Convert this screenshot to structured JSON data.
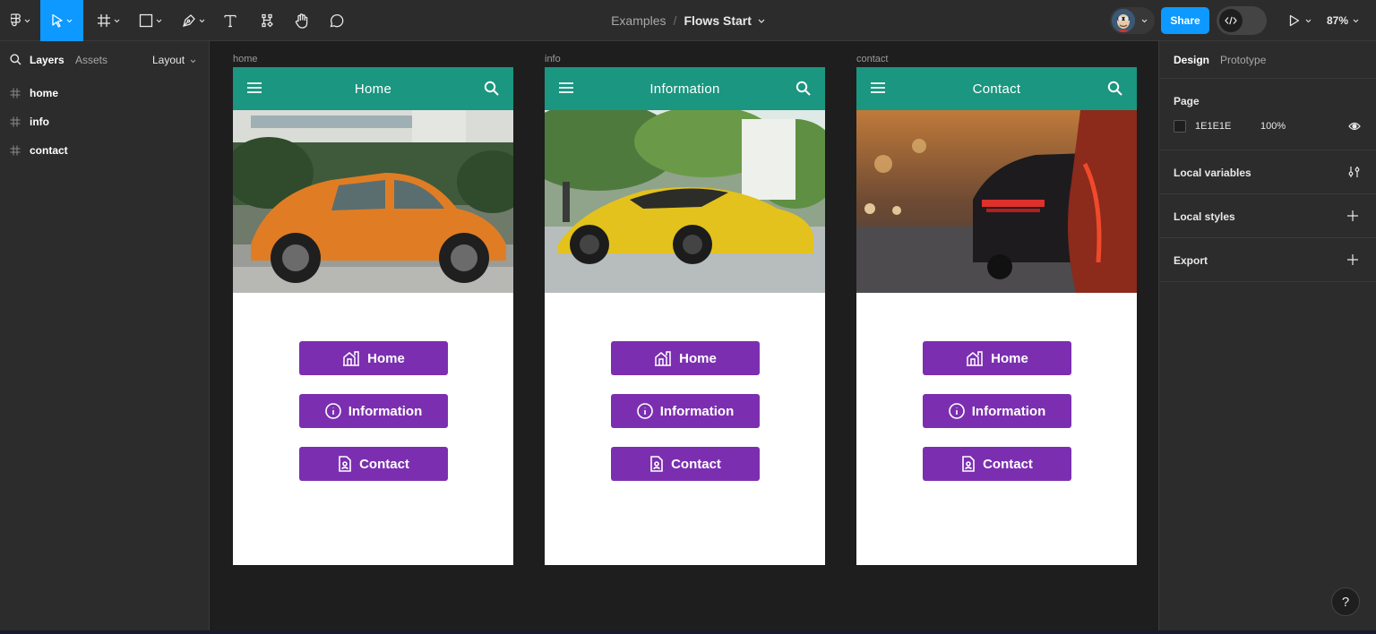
{
  "toolbar": {
    "breadcrumb": {
      "project": "Examples",
      "separator": "/",
      "file": "Flows Start"
    },
    "share_label": "Share",
    "zoom": "87%",
    "tools": [
      "main-menu-icon",
      "move-tool-icon",
      "frame-tool-icon",
      "shape-tool-icon",
      "pen-tool-icon",
      "text-tool-icon",
      "components-icon",
      "hand-tool-icon",
      "comment-icon"
    ]
  },
  "left_panel": {
    "tabs": {
      "layers": "Layers",
      "assets": "Assets",
      "layout": "Layout"
    },
    "layers": [
      {
        "name": "home"
      },
      {
        "name": "info"
      },
      {
        "name": "contact"
      }
    ]
  },
  "canvas": {
    "frames": [
      {
        "label": "home",
        "title": "Home",
        "photo": "orange-beetle-photo"
      },
      {
        "label": "info",
        "title": "Information",
        "photo": "yellow-sportscar-photo"
      },
      {
        "label": "contact",
        "title": "Contact",
        "photo": "dark-sportscar-photo"
      }
    ],
    "nav_buttons": [
      {
        "label": "Home",
        "icon": "building-icon"
      },
      {
        "label": "Information",
        "icon": "info-circle-icon"
      },
      {
        "label": "Contact",
        "icon": "contact-card-icon"
      }
    ],
    "colors": {
      "appbar": "#1b9680",
      "button": "#7b2fb0",
      "frame_bg": "#ffffff",
      "canvas_bg": "#1e1e1e"
    }
  },
  "right_panel": {
    "tabs": {
      "design": "Design",
      "prototype": "Prototype"
    },
    "page": {
      "heading": "Page",
      "color_hex": "1E1E1E",
      "opacity": "100%"
    },
    "sections": {
      "local_variables": "Local variables",
      "local_styles": "Local styles",
      "export": "Export"
    }
  },
  "help_label": "?"
}
